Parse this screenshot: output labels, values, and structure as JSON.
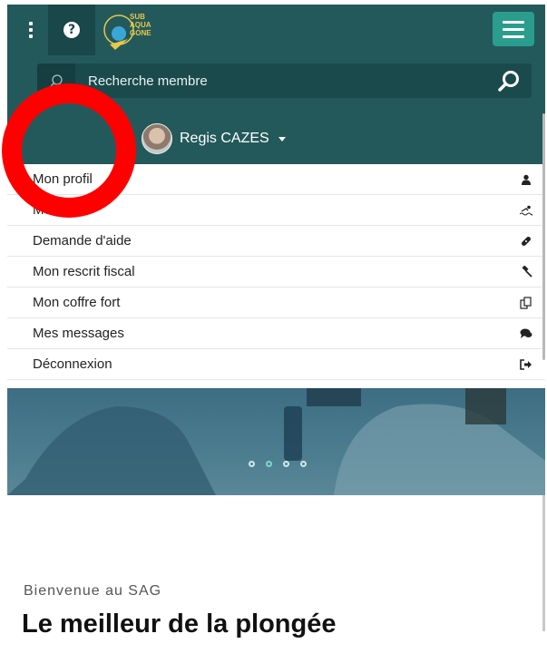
{
  "header": {
    "menu_label": "",
    "logo_text": [
      "SUB",
      "AQUA",
      "GONE"
    ]
  },
  "search": {
    "placeholder": "Recherche membre"
  },
  "user": {
    "name": "Regis CAZES"
  },
  "dropdown": {
    "items": [
      {
        "label": "Mon profil",
        "icon": "user-icon"
      },
      {
        "label": "Mes ... ",
        "icon": "swim-icon"
      },
      {
        "label": "Demande d'aide",
        "icon": "bandage-icon"
      },
      {
        "label": "Mon rescrit fiscal",
        "icon": "gavel-icon"
      },
      {
        "label": "Mon coffre fort",
        "icon": "copy-icon"
      },
      {
        "label": "Mes messages",
        "icon": "comments-icon"
      },
      {
        "label": "Déconnexion",
        "icon": "sign-out-icon"
      }
    ]
  },
  "carousel": {
    "slide_count": 4,
    "active_index": 1
  },
  "content": {
    "welcome": "Bienvenue au SAG",
    "headline": "Le meilleur de la plongée"
  },
  "colors": {
    "header_bg": "#23595b",
    "accent": "#2a9d8f",
    "annotation": "#ff0000"
  }
}
